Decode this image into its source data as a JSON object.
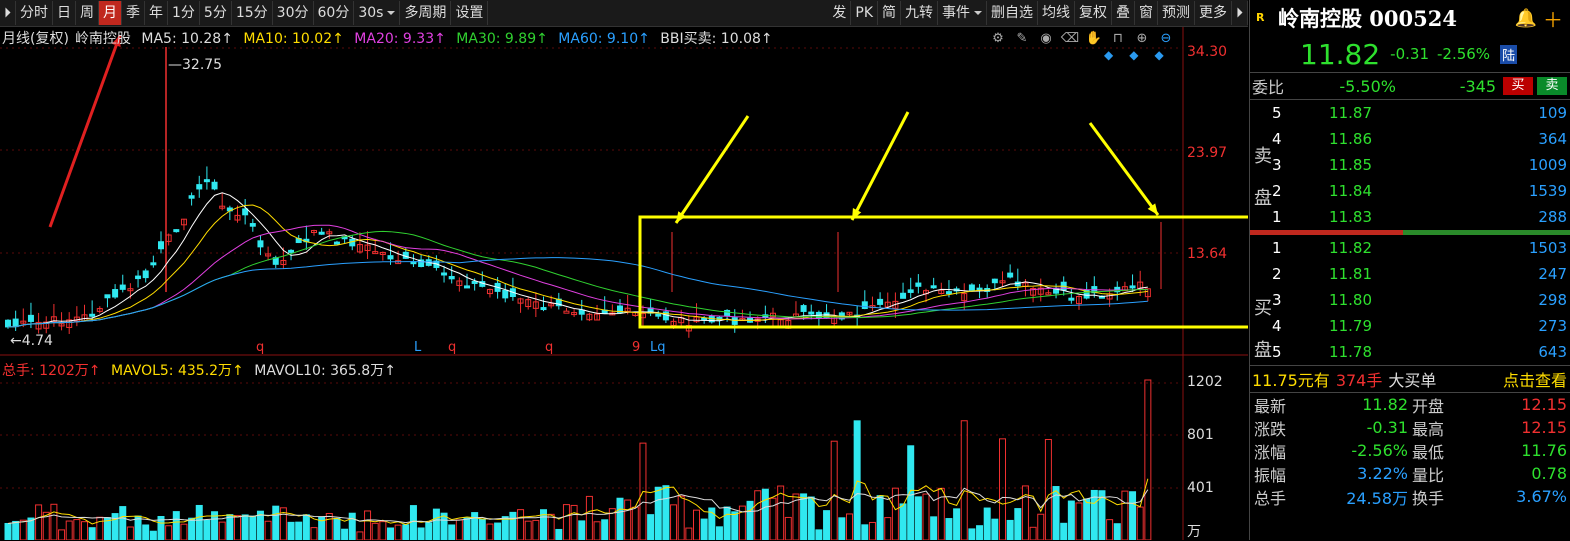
{
  "toolbar": {
    "left_items": [
      "分时",
      "日",
      "周",
      "月",
      "季",
      "年",
      "1分",
      "5分",
      "15分",
      "30分",
      "60分"
    ],
    "active_item": "月",
    "interval_select": "30s",
    "multi_period": "多周期",
    "settings": "设置",
    "right_items": [
      "发",
      "PK",
      "简",
      "九转",
      "事件",
      "删自选",
      "均线",
      "复权",
      "叠",
      "窗",
      "预测",
      "更多"
    ]
  },
  "legend": {
    "period": "月线(复权)",
    "name": "岭南控股",
    "ma5": "MA5: 10.28↑",
    "ma10": "MA10: 10.02↑",
    "ma20": "MA20: 9.33↑",
    "ma30": "MA30: 9.89↑",
    "ma60": "MA60: 9.10↑",
    "bbi": "BBI买卖: 10.08↑"
  },
  "vol_legend": {
    "total": "总手: 1202万↑",
    "mavol5": "MAVOL5: 435.2万↑",
    "mavol10": "MAVOL10: 365.8万↑"
  },
  "price_axis": [
    "34.30",
    "23.97",
    "13.64"
  ],
  "vol_axis": [
    "1202",
    "801",
    "401",
    "万"
  ],
  "annotations": {
    "high": "32.75",
    "low": "4.74",
    "marker_row": [
      "q",
      "L",
      "q",
      "q",
      "9",
      "Lq"
    ]
  },
  "colors": {
    "up": "#f03030",
    "down": "#30e8f0",
    "ma5": "#ffffff",
    "ma10": "#ffdd00",
    "ma20": "#e040e0",
    "ma30": "#30d030",
    "ma60": "#2aa0ff",
    "highlight": "#ffff00"
  },
  "panel": {
    "badge": "R",
    "stock_title": "岭南控股 000524",
    "price": "11.82",
    "change": "-0.31",
    "change_pct": "-2.56%",
    "board": "陆",
    "weibi_label": "委比",
    "weibi_pct": "-5.50%",
    "weibi_diff": "-345",
    "buy_btn": "买",
    "sell_btn": "卖",
    "sell_label_1": "卖",
    "sell_label_2": "盘",
    "buy_label_1": "买",
    "buy_label_2": "盘",
    "asks": [
      {
        "lvl": "5",
        "price": "11.87",
        "vol": "109"
      },
      {
        "lvl": "4",
        "price": "11.86",
        "vol": "364"
      },
      {
        "lvl": "3",
        "price": "11.85",
        "vol": "1009"
      },
      {
        "lvl": "2",
        "price": "11.84",
        "vol": "1539"
      },
      {
        "lvl": "1",
        "price": "11.83",
        "vol": "288"
      }
    ],
    "bids": [
      {
        "lvl": "1",
        "price": "11.82",
        "vol": "1503"
      },
      {
        "lvl": "2",
        "price": "11.81",
        "vol": "247"
      },
      {
        "lvl": "3",
        "price": "11.80",
        "vol": "298"
      },
      {
        "lvl": "4",
        "price": "11.79",
        "vol": "273"
      },
      {
        "lvl": "5",
        "price": "11.78",
        "vol": "643"
      }
    ],
    "big_order": {
      "now": "11.75元有",
      "qty": "374手",
      "type": "大买单",
      "action": "点击查看"
    },
    "stats": [
      {
        "l1": "最新",
        "v1": "11.82",
        "c1": "#2ee02e",
        "l2": "开盘",
        "v2": "12.15",
        "c2": "#f03030"
      },
      {
        "l1": "涨跌",
        "v1": "-0.31",
        "c1": "#2ee02e",
        "l2": "最高",
        "v2": "12.15",
        "c2": "#f03030"
      },
      {
        "l1": "涨幅",
        "v1": "-2.56%",
        "c1": "#2ee02e",
        "l2": "最低",
        "v2": "11.76",
        "c2": "#2ee02e"
      },
      {
        "l1": "振幅",
        "v1": "3.22%",
        "c1": "#2aa0ff",
        "l2": "量比",
        "v2": "0.78",
        "c2": "#2ee02e"
      },
      {
        "l1": "总手",
        "v1": "24.58万",
        "c1": "#2aa0ff",
        "l2": "换手",
        "v2": "3.67%",
        "c2": "#2aa0ff"
      }
    ]
  }
}
